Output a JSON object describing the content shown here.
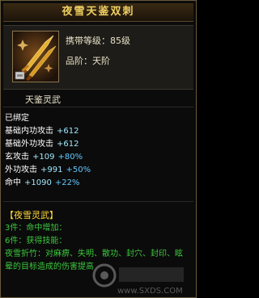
{
  "item": {
    "name": "夜雪天鉴双刺",
    "level_label": "携带等级：",
    "level_value": "85级",
    "grade_label": "品阶：",
    "grade_value": "天阶",
    "subtitle": "天鉴灵武",
    "icon": "dual-dagger-icon"
  },
  "bound_text": "已绑定",
  "stats": [
    {
      "name": "基础内功攻击",
      "value": "+612",
      "pct": ""
    },
    {
      "name": "基础外功攻击",
      "value": "+612",
      "pct": ""
    },
    {
      "name": "玄攻击",
      "value": "+109",
      "pct": "+80%"
    },
    {
      "name": "外功攻击",
      "value": "+991",
      "pct": "+50%"
    },
    {
      "name": "命中",
      "value": "+1090",
      "pct": "+22%"
    }
  ],
  "set": {
    "title": "【夜雪灵武】",
    "lines": [
      "3件：命中增加：",
      "6件：获得技能："
    ],
    "desc": "夜雪折竹：对麻痹、失明、散功、封穴、封印、眩晕的目标造成的伤害提高"
  },
  "watermark": "www.SXDS.COM",
  "colors": {
    "title": "#f0d060",
    "stat_value": "#a0e8ff",
    "stat_pct": "#64c8ff",
    "set_title": "#ffd83a",
    "set_text": "#3cc83c"
  }
}
